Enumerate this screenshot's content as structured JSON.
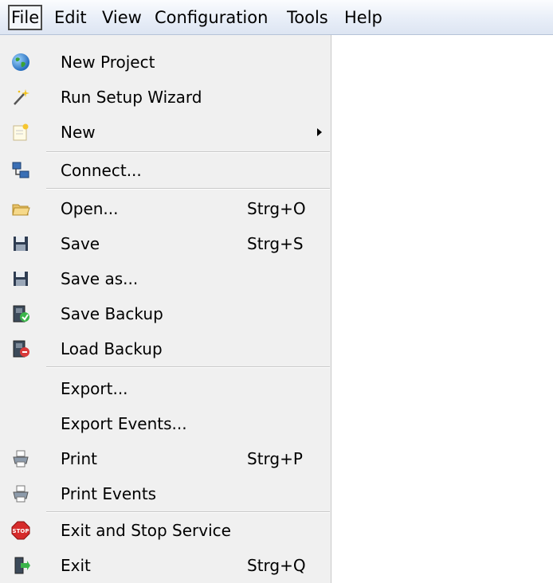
{
  "menubar": {
    "items": [
      {
        "label": "File"
      },
      {
        "label": "Edit"
      },
      {
        "label": "View"
      },
      {
        "label": "Configuration"
      },
      {
        "label": "Tools"
      },
      {
        "label": "Help"
      }
    ]
  },
  "file_menu": {
    "items": [
      {
        "label": "New Project",
        "icon": "globe-icon"
      },
      {
        "label": "Run Setup Wizard",
        "icon": "wizard-wand-icon"
      },
      {
        "label": "New",
        "icon": "new-document-icon",
        "submenu": true
      },
      {
        "label": "Connect...",
        "icon": "network-connect-icon"
      },
      {
        "label": "Open...",
        "icon": "open-folder-icon",
        "shortcut": "Strg+O"
      },
      {
        "label": "Save",
        "icon": "floppy-disk-icon",
        "shortcut": "Strg+S"
      },
      {
        "label": "Save as...",
        "icon": "floppy-disk-icon"
      },
      {
        "label": "Save Backup",
        "icon": "save-backup-icon"
      },
      {
        "label": "Load Backup",
        "icon": "load-backup-icon"
      },
      {
        "label": "Export...",
        "icon": ""
      },
      {
        "label": "Export Events...",
        "icon": ""
      },
      {
        "label": "Print",
        "icon": "printer-icon",
        "shortcut": "Strg+P"
      },
      {
        "label": "Print Events",
        "icon": "printer-icon"
      },
      {
        "label": "Exit and Stop Service",
        "icon": "stop-sign-icon"
      },
      {
        "label": "Exit",
        "icon": "exit-door-icon",
        "shortcut": "Strg+Q"
      }
    ]
  }
}
